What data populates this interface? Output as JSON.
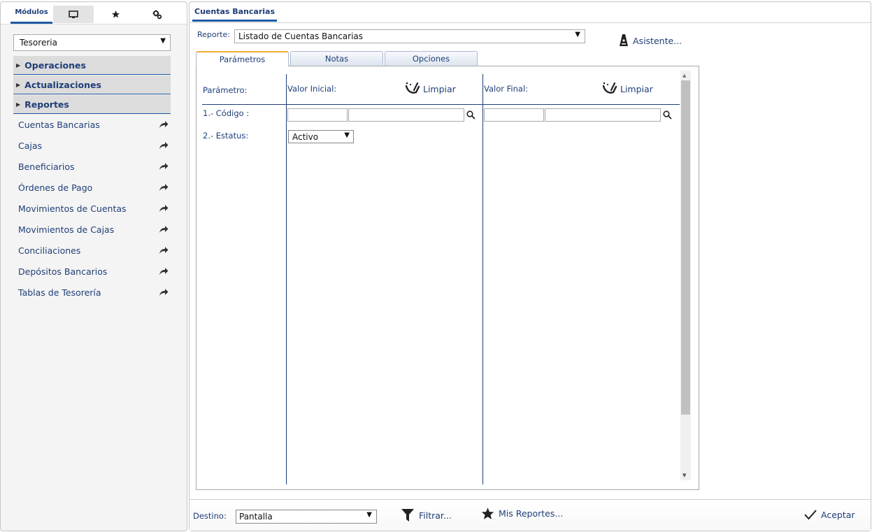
{
  "left_tabs": {
    "modulos": "Módulos",
    "monitor_icon": "monitor-icon",
    "star_icon": "star-icon",
    "gear_icon": "gears-icon"
  },
  "module_select": {
    "value": "Tesoreria"
  },
  "groups": [
    "Operaciones",
    "Actualizaciones",
    "Reportes"
  ],
  "nav_items": [
    "Cuentas Bancarias",
    "Cajas",
    "Beneficiarios",
    "Órdenes de Pago",
    "Movimientos de Cuentas",
    "Movimientos de Cajas",
    "Conciliaciones",
    "Depósitos Bancarios",
    "Tablas de Tesorería"
  ],
  "right": {
    "title": "Cuentas Bancarias",
    "reporte_label": "Reporte:",
    "reporte_value": "Listado de Cuentas Bancarias",
    "asistente": "Asistente...",
    "subtabs": {
      "parametros": "Parámetros",
      "notas": "Notas",
      "opciones": "Opciones"
    },
    "params": {
      "col_parametro": "Parámetro:",
      "col_inicial": "Valor Inicial:",
      "col_final": "Valor Final:",
      "limpiar": "Limpiar",
      "row1_label": "1.- Código :",
      "row2_label": "2.- Estatus:",
      "estatus_value": "Activo"
    },
    "footer": {
      "destino_label": "Destino:",
      "destino_value": "Pantalla",
      "filtrar": "Filtrar...",
      "mis_reportes": "Mis Reportes...",
      "aceptar": "Aceptar"
    }
  },
  "colors": {
    "accent": "#1f3e78",
    "tab_underline": "#1f5aa6",
    "active_subtab": "#f0b030"
  }
}
